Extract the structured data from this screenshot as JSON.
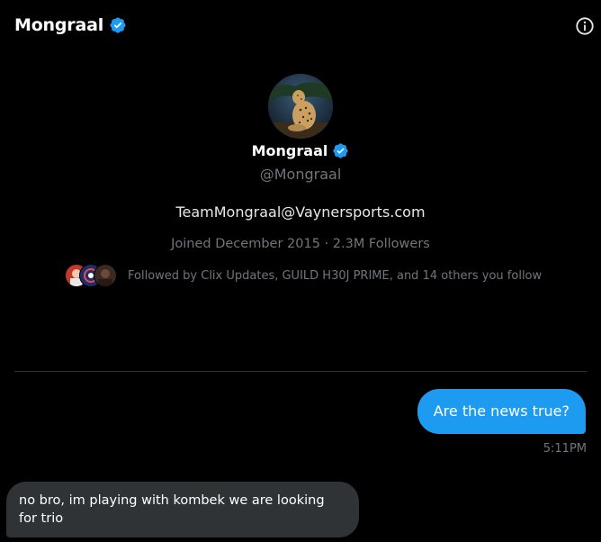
{
  "header": {
    "title": "Mongraal",
    "verified_icon": "verified-badge-icon",
    "info_icon": "info-icon"
  },
  "profile": {
    "avatar": "leopard-avatar",
    "name": "Mongraal",
    "handle": "@Mongraal",
    "bio": "TeamMongraal@Vaynersports.com",
    "meta": "Joined December 2015 · 2.3M Followers",
    "followed_by": "Followed by Clix Updates, GUILD H30J PRIME, and 14 others you follow"
  },
  "messages": [
    {
      "direction": "sent",
      "text": "Are the news true?",
      "time": "5:11PM"
    },
    {
      "direction": "received",
      "text": "no bro, im playing with kombek we are looking for trio"
    }
  ],
  "colors": {
    "background": "#000000",
    "accent": "#1d9bf0",
    "muted_text": "#71767b",
    "received_bubble": "#2f3336",
    "divider": "#2f3336"
  }
}
